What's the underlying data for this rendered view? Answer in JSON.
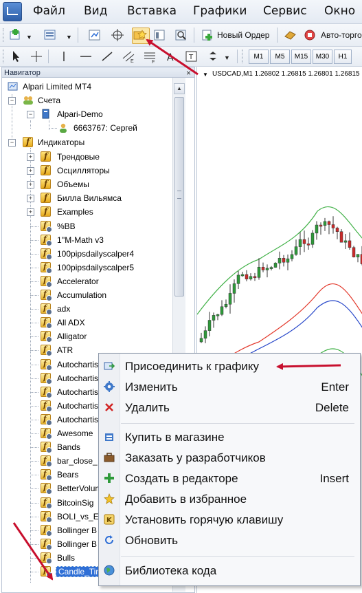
{
  "menubar": {
    "items": [
      "Файл",
      "Вид",
      "Вставка",
      "Графики",
      "Сервис",
      "Окно"
    ]
  },
  "toolbar": {
    "new_order_label": "Новый Ордер",
    "autotrading_label": "Авто-торговля",
    "timeframes": [
      "M1",
      "M5",
      "M15",
      "M30",
      "H1"
    ]
  },
  "navigator": {
    "title": "Навигатор",
    "close_glyph": "×",
    "broker": "Alpari Limited MT4",
    "accounts_label": "Счета",
    "account_server": "Alpari-Demo",
    "account_user": "6663767: Сергей",
    "indicators_label": "Индикаторы",
    "folders": [
      "Трендовые",
      "Осцилляторы",
      "Объемы",
      "Билла Вильямса",
      "Examples"
    ],
    "items": [
      "%BB",
      "1''M-Math v3",
      "100pipsdailyscalper4",
      "100pipsdailyscalper5",
      "Accelerator",
      "Accumulation",
      "adx",
      "All ADX",
      "Alligator",
      "ATR",
      "Autochartist",
      "Autochartist",
      "Autochartist",
      "Autochartist",
      "Autochartist",
      "Awesome",
      "Bands",
      "bar_close_",
      "Bears",
      "BetterVolume",
      "BitcoinSig",
      "BOLI_vs_EI",
      "Bollinger B",
      "Bollinger B",
      "Bulls"
    ],
    "selected_item": "Candle_Time_blue"
  },
  "chart": {
    "title": "USDCAD,M1  1.26802 1.26815 1.26801 1.26815",
    "colors": {
      "bull": "#2e9a3a",
      "bear": "#cc2a2a",
      "upper_band": "#44b24a",
      "ma_red": "#e33a2d",
      "ma_blue": "#2747c9"
    }
  },
  "context_menu": {
    "items": [
      {
        "label": "Присоединить к графику",
        "shortcut": "",
        "icon": "attach-chart-icon"
      },
      {
        "label": "Изменить",
        "shortcut": "Enter",
        "icon": "gear-icon"
      },
      {
        "label": "Удалить",
        "shortcut": "Delete",
        "icon": "delete-x-icon"
      },
      {
        "label": "Купить в магазине",
        "shortcut": "",
        "icon": "market-icon"
      },
      {
        "label": "Заказать у разработчиков",
        "shortcut": "",
        "icon": "briefcase-icon"
      },
      {
        "label": "Создать в редакторе",
        "shortcut": "Insert",
        "icon": "plus-icon"
      },
      {
        "label": "Добавить в избранное",
        "shortcut": "",
        "icon": "star-icon"
      },
      {
        "label": "Установить горячую клавишу",
        "shortcut": "",
        "icon": "hotkey-icon"
      },
      {
        "label": "Обновить",
        "shortcut": "",
        "icon": "refresh-icon"
      },
      {
        "label": "Библиотека кода",
        "shortcut": "",
        "icon": "globe-icon"
      }
    ]
  },
  "annotations": {
    "arrow_color": "#c8102e"
  }
}
